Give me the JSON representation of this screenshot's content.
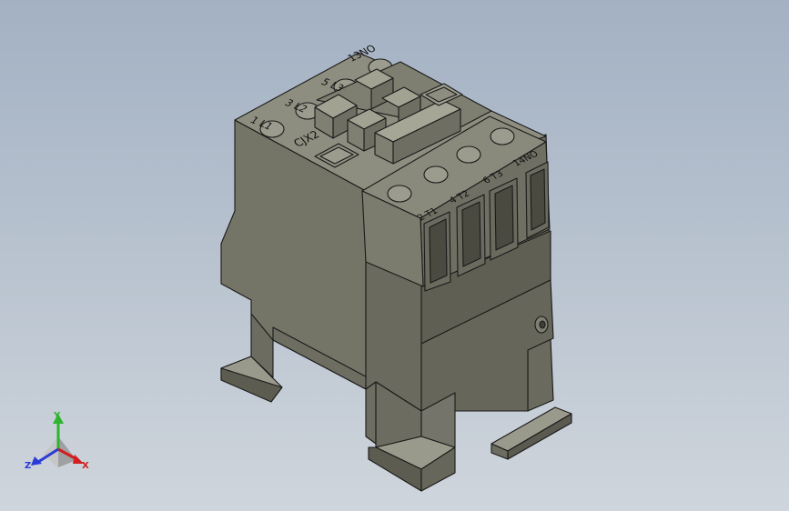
{
  "viewport": {
    "background_top": "#a3b1c3",
    "background_bottom": "#cfd5dc"
  },
  "model": {
    "body_color": "#747467",
    "edge_color": "#1a1a1a",
    "top_labels": {
      "l1": "1 L1",
      "l2": "3 L2",
      "l3": "5 L3",
      "no13": "13NO",
      "brand": "CJX2"
    },
    "bottom_labels": {
      "t1": "2 T1",
      "t2": "4 T2",
      "t3": "6 T3",
      "no14": "14NO"
    }
  },
  "triad": {
    "x_label": "X",
    "y_label": "Y",
    "z_label": "Z",
    "x_color": "#d21e1e",
    "y_color": "#2db52d",
    "z_color": "#2a3bd8"
  }
}
